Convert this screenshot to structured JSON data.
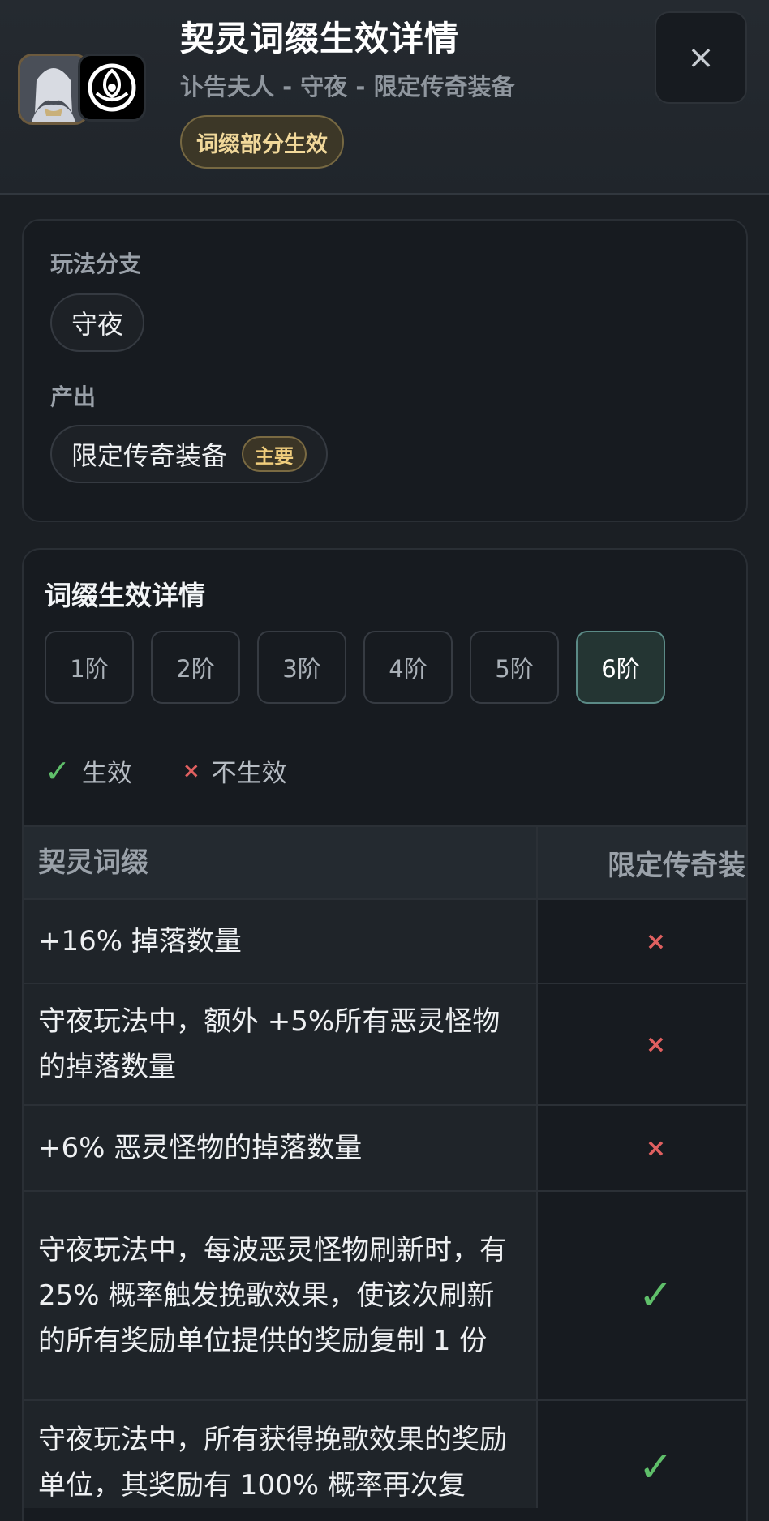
{
  "header": {
    "title": "契灵词缀生效详情",
    "subtitle": "讣告夫人 - 守夜 - 限定传奇装备",
    "status_badge": "词缀部分生效",
    "close_icon": "×"
  },
  "info": {
    "branch_label": "玩法分支",
    "branch_value": "守夜",
    "output_label": "产出",
    "output_value": "限定传奇装备",
    "output_tag": "主要"
  },
  "details": {
    "section_title": "词缀生效详情",
    "tiers": [
      "1阶",
      "2阶",
      "3阶",
      "4阶",
      "5阶",
      "6阶"
    ],
    "active_tier": "6阶",
    "legend": {
      "effective_icon": "✓",
      "effective_label": "生效",
      "ineffective_icon": "×",
      "ineffective_label": "不生效"
    },
    "table": {
      "col_affix": "契灵词缀",
      "col_equipment": "限定传奇装",
      "rows": [
        {
          "affix": "+16% 掉落数量",
          "mark": "×"
        },
        {
          "affix": "守夜玩法中，额外 +5%所有恶灵怪物的掉落数量",
          "mark": "×"
        },
        {
          "affix": "+6% 恶灵怪物的掉落数量",
          "mark": "×"
        },
        {
          "affix": "守夜玩法中，每波恶灵怪物刷新时，有 25% 概率触发挽歌效果，使该次刷新的所有奖励单位提供的奖励复制 1 份",
          "mark": "✓"
        },
        {
          "affix": "守夜玩法中，所有获得挽歌效果的奖励单位，其奖励有 100% 概率再次复",
          "mark": "✓"
        }
      ]
    }
  }
}
